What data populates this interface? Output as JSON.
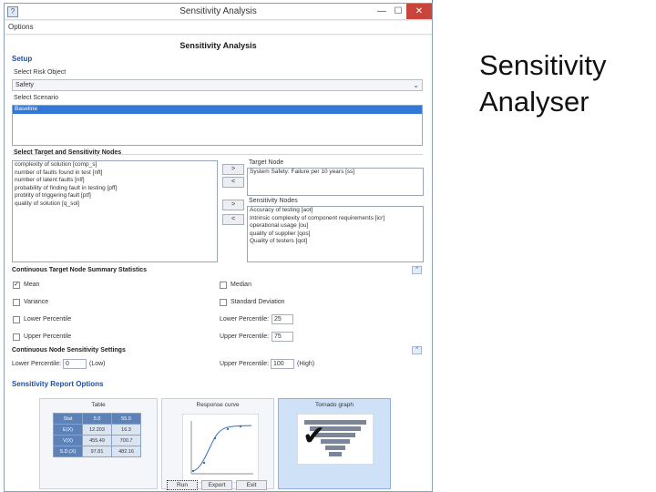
{
  "window": {
    "title": "Sensitivity Analysis",
    "icon_glyph": "?",
    "controls": {
      "minimize": "—",
      "maximize": "☐",
      "close": "✕"
    }
  },
  "menu": {
    "options": "Options"
  },
  "main": {
    "heading": "Sensitivity Analysis",
    "setup": {
      "label": "Setup",
      "risk_object_label": "Select Risk Object",
      "risk_object_value": "Safety",
      "scenario_label": "Select Scenario",
      "scenarios": [
        "Baseline"
      ]
    },
    "nodes": {
      "label": "Select Target and Sensitivity Nodes",
      "available": [
        "complexity of solution [comp_s]",
        "number of faults found in test [nft]",
        "number of latent faults [nlf]",
        "probability of finding fault in testing [pff]",
        "problity of triggering fault [ptf]",
        "quality of solution [q_sol]"
      ],
      "add_label": ">",
      "remove_label": "<",
      "target_label": "Target Node",
      "target_items": [
        "System Safety: Failure per 10 years [ss]"
      ],
      "sensitivity_label": "Sensitivity Nodes",
      "sensitivity_items": [
        "Accuracy of testing [aot]",
        "Intrinsic complexity of component requirements [icr]",
        "operational usage [ou]",
        "quality of supplier [qos]",
        "Quality of testers [qot]"
      ]
    },
    "summary_stats": {
      "label": "Continuous Target Node Summary Statistics",
      "mean": "Mean",
      "median": "Median",
      "variance": "Variance",
      "std_dev": "Standard Deviation",
      "lower_percentile": "Lower Percentile",
      "upper_percentile": "Upper Percentile",
      "lower_percentile_field": "Lower Percentile:",
      "lower_percentile_value": "25",
      "upper_percentile_field": "Upper Percentile:",
      "upper_percentile_value": "75",
      "mean_checked": "✓"
    },
    "sensitivity_settings": {
      "label": "Continuous Node Sensitivity Settings",
      "lower_label": "Lower Percentile:",
      "lower_value": "0",
      "lower_hint": "(Low)",
      "upper_label": "Upper Percentile:",
      "upper_value": "100",
      "upper_hint": "(High)"
    },
    "report_options": {
      "label": "Sensitivity Report Options",
      "table_title": "Table",
      "response_title": "Response curve",
      "tornado_title": "Tornado graph",
      "mini_table": [
        [
          "Stat",
          "5.0",
          "55.0"
        ],
        [
          "E(X)",
          "12.203",
          "16.3"
        ],
        [
          "V(X)",
          "455.49",
          "700.7"
        ],
        [
          "S.D.(X)",
          "97.81",
          "482.16"
        ]
      ],
      "tornado_check": "✔"
    },
    "buttons": {
      "run": "Run",
      "export": "Export",
      "exit": "Exit"
    }
  },
  "collapse_glyph": "^",
  "slide": {
    "title_line1": "Sensitivity",
    "title_line2": "Analyser"
  }
}
